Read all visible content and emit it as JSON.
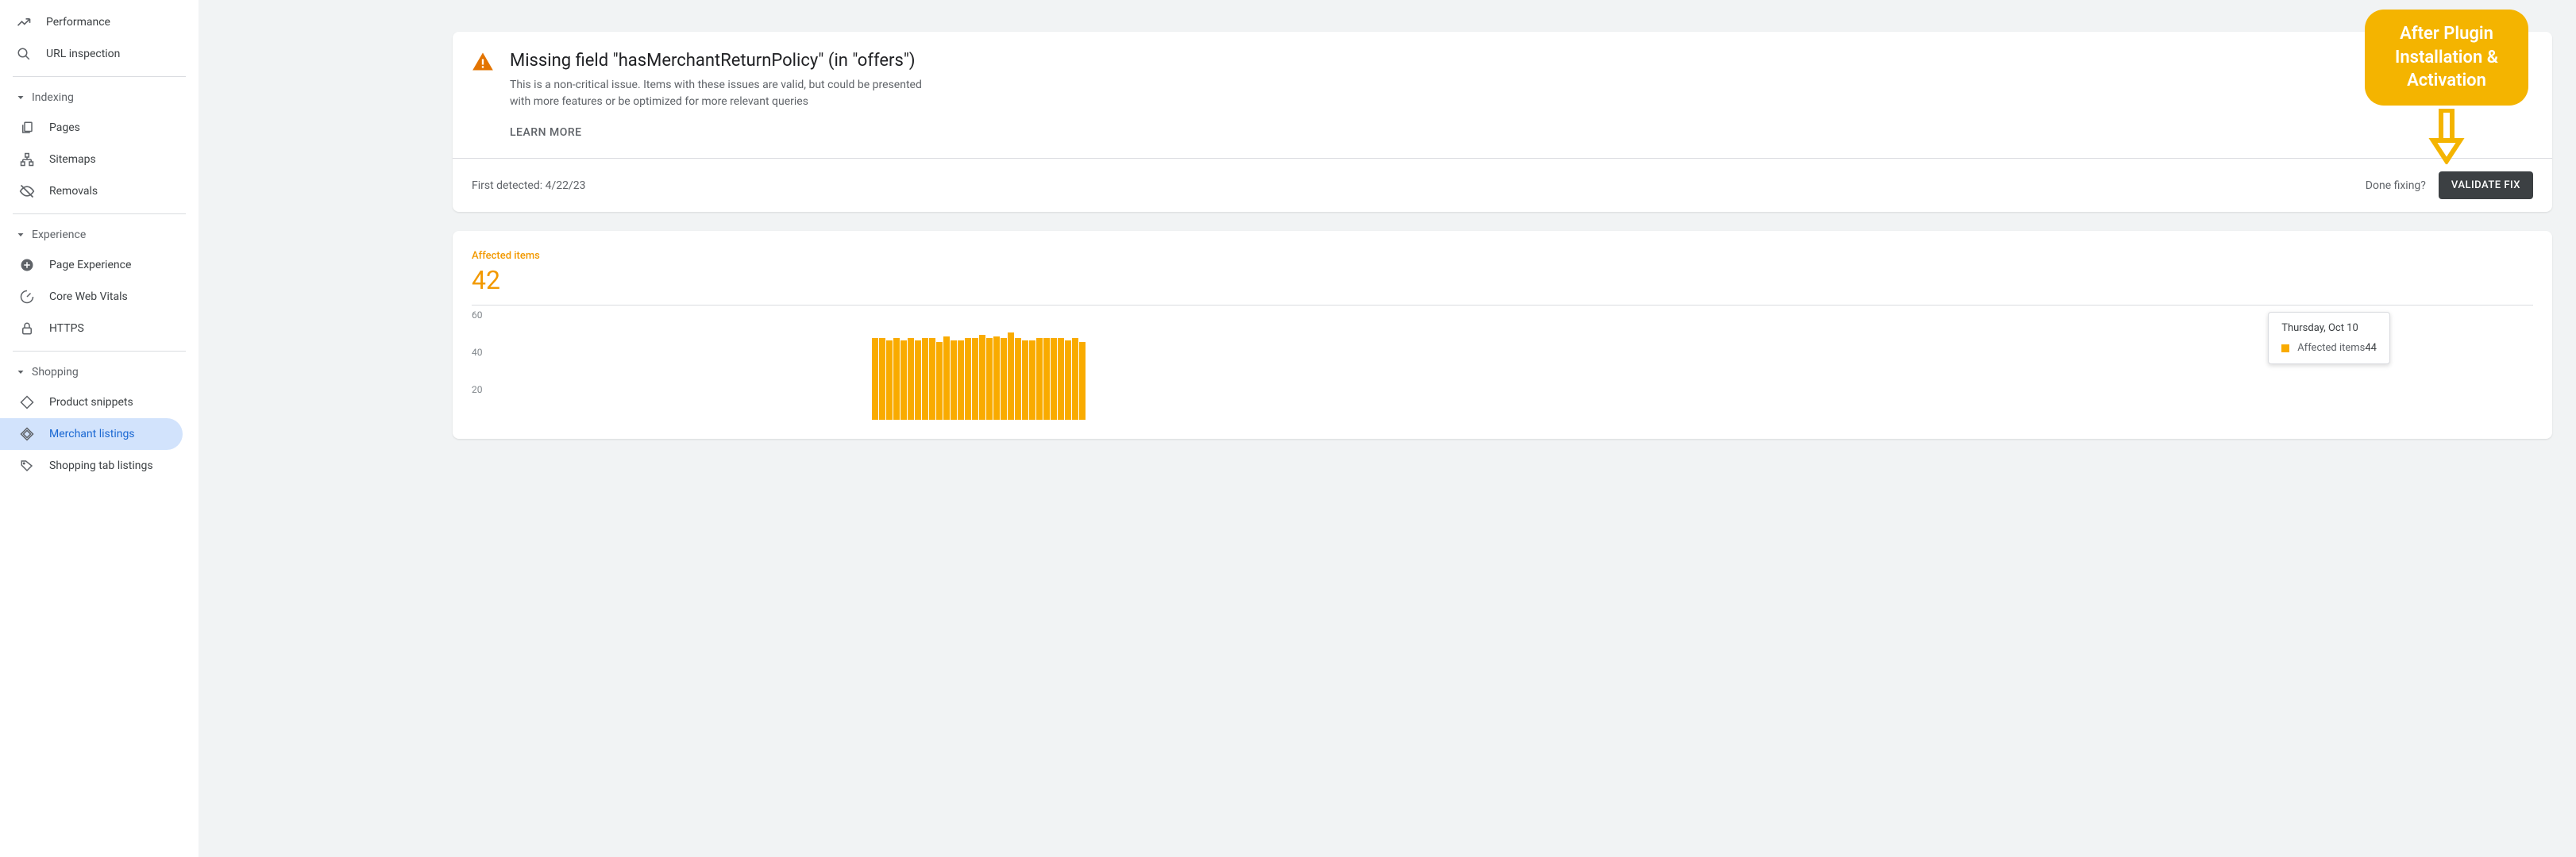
{
  "sidebar": {
    "top_items": [
      {
        "label": "Performance",
        "icon": "trend"
      },
      {
        "label": "URL inspection",
        "icon": "search"
      }
    ],
    "sections": [
      {
        "label": "Indexing",
        "items": [
          {
            "label": "Pages",
            "icon": "pages"
          },
          {
            "label": "Sitemaps",
            "icon": "sitemaps"
          },
          {
            "label": "Removals",
            "icon": "removals"
          }
        ]
      },
      {
        "label": "Experience",
        "items": [
          {
            "label": "Page Experience",
            "icon": "plus"
          },
          {
            "label": "Core Web Vitals",
            "icon": "speed"
          },
          {
            "label": "HTTPS",
            "icon": "lock"
          }
        ]
      },
      {
        "label": "Shopping",
        "items": [
          {
            "label": "Product snippets",
            "icon": "diamond"
          },
          {
            "label": "Merchant listings",
            "icon": "diamond",
            "active": true
          },
          {
            "label": "Shopping tab listings",
            "icon": "tag"
          }
        ]
      }
    ]
  },
  "issue": {
    "title": "Missing field \"hasMerchantReturnPolicy\" (in \"offers\")",
    "description": "This is a non-critical issue. Items with these issues are valid, but could be presented with more features or be optimized for more relevant queries",
    "learn_more": "LEARN MORE",
    "first_detected_label": "First detected: 4/22/23",
    "done_fixing": "Done fixing?",
    "validate": "VALIDATE FIX"
  },
  "chart": {
    "label": "Affected items",
    "value": "42",
    "y_ticks": [
      "60",
      "40",
      "20"
    ],
    "tooltip": {
      "date": "Thursday, Oct 10",
      "series": "Affected items",
      "value": "44"
    }
  },
  "chart_data": {
    "type": "bar",
    "title": "Affected items",
    "ylabel": "Affected items",
    "ylim": [
      0,
      60
    ],
    "tooltip_date": "Thursday, Oct 10",
    "tooltip_value": 44,
    "values": [
      44,
      44,
      43,
      44,
      43,
      44,
      43,
      44,
      44,
      42,
      45,
      43,
      43,
      44,
      44,
      46,
      44,
      45,
      44,
      47,
      44,
      43,
      43,
      44,
      44,
      44,
      44,
      43,
      44,
      42
    ]
  },
  "overlay": {
    "line1": "After Plugin",
    "line2": "Installation &",
    "line3": "Activation"
  }
}
